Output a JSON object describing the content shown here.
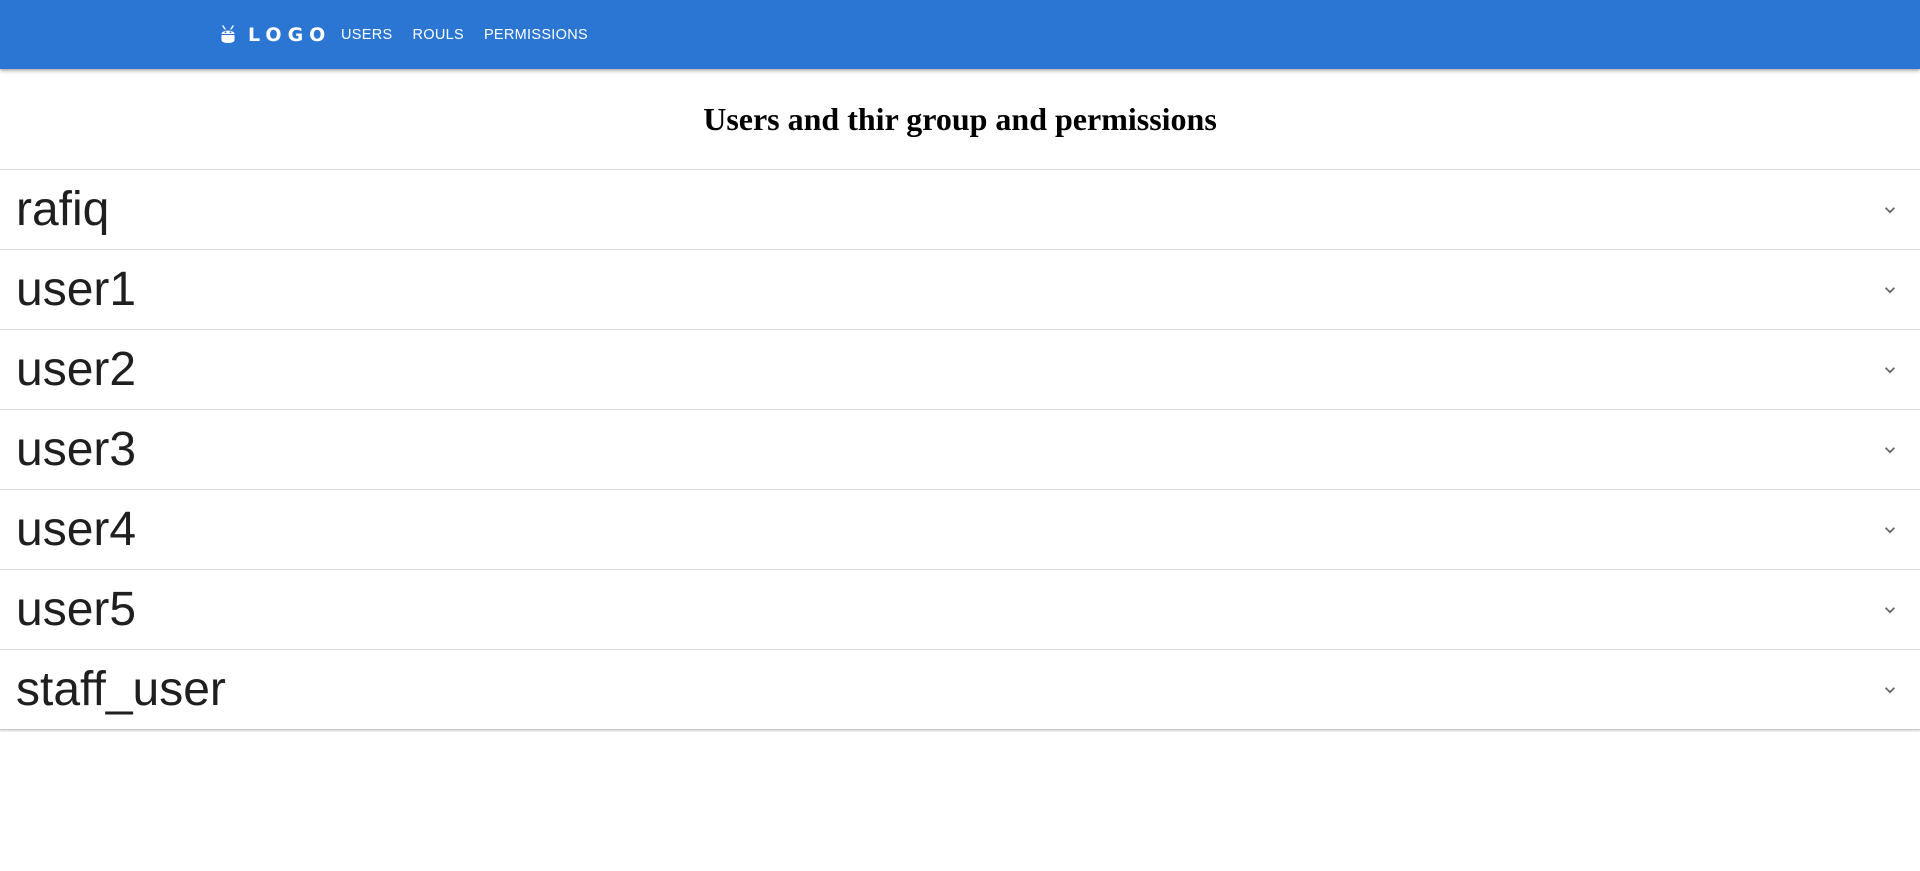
{
  "header": {
    "logo_text": "LOGO",
    "logo_icon": "adb-android-icon",
    "nav": [
      {
        "label": "USERS"
      },
      {
        "label": "ROULS"
      },
      {
        "label": "PERMISSIONS"
      }
    ],
    "background_color": "#2b76d2"
  },
  "main": {
    "title": "Users and thir group and permissions",
    "users": [
      {
        "name": "rafiq"
      },
      {
        "name": "user1"
      },
      {
        "name": "user2"
      },
      {
        "name": "user3"
      },
      {
        "name": "user4"
      },
      {
        "name": "user5"
      },
      {
        "name": "staff_user"
      }
    ],
    "expand_icon": "chevron-down-icon"
  }
}
